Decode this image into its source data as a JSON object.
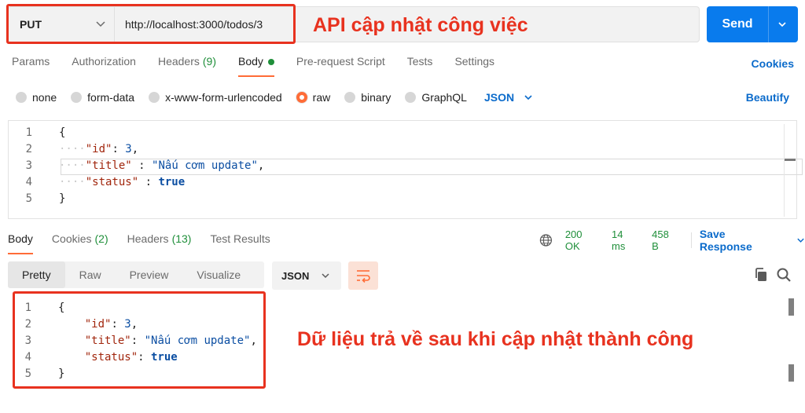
{
  "request": {
    "method": "PUT",
    "url": "http://localhost:3000/todos/3",
    "send_label": "Send"
  },
  "annotations": {
    "top": "API cập nhật công việc",
    "bottom": "Dữ liệu trả về sau khi cập nhật thành công"
  },
  "req_tabs": {
    "params": "Params",
    "authorization": "Authorization",
    "headers": "Headers",
    "headers_count": "(9)",
    "body": "Body",
    "prerequest": "Pre-request Script",
    "tests": "Tests",
    "settings": "Settings",
    "cookies": "Cookies"
  },
  "body_types": {
    "none": "none",
    "form_data": "form-data",
    "urlencoded": "x-www-form-urlencoded",
    "raw": "raw",
    "binary": "binary",
    "graphql": "GraphQL",
    "format": "JSON",
    "beautify": "Beautify"
  },
  "request_body": {
    "line_numbers": [
      "1",
      "2",
      "3",
      "4",
      "5"
    ],
    "open": "{",
    "id_key": "\"id\"",
    "id_val": "3",
    "title_key": "\"title\"",
    "title_val": "\"Nấu cơm update\"",
    "status_key": "\"status\"",
    "status_val": "true",
    "close": "}"
  },
  "resp_tabs": {
    "body": "Body",
    "cookies": "Cookies",
    "cookies_count": "(2)",
    "headers": "Headers",
    "headers_count": "(13)",
    "test_results": "Test Results"
  },
  "resp_meta": {
    "status": "200 OK",
    "time": "14 ms",
    "size": "458 B",
    "save": "Save Response"
  },
  "view_modes": {
    "pretty": "Pretty",
    "raw": "Raw",
    "preview": "Preview",
    "visualize": "Visualize",
    "format": "JSON"
  },
  "response_body": {
    "line_numbers": [
      "1",
      "2",
      "3",
      "4",
      "5"
    ],
    "open": "{",
    "id_key": "\"id\"",
    "id_val": "3",
    "title_key": "\"title\"",
    "title_val": "\"Nấu cơm update\"",
    "status_key": "\"status\"",
    "status_val": "true",
    "close": "}"
  },
  "colors": {
    "accent_orange": "#ff6c37",
    "send_blue": "#097bed",
    "link_blue": "#0b6bcb",
    "success_green": "#1f8f3a",
    "annotation_red": "#e8321f"
  },
  "icons": [
    "chevron-down-icon",
    "globe-icon",
    "wrap-lines-icon",
    "copy-icon",
    "search-icon"
  ]
}
